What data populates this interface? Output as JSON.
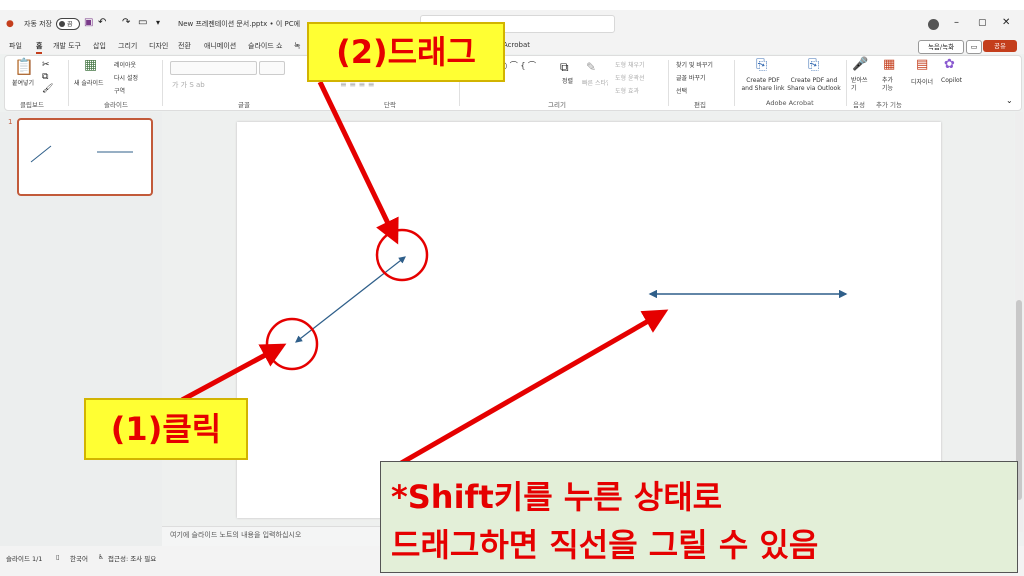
{
  "titlebar": {
    "autosave_label": "자동 저장",
    "autosave_state": "끔",
    "filename": "New 프레젠테이션 문서.pptx • 이 PC에 저장됨"
  },
  "menu": {
    "tabs": [
      "파일",
      "홈",
      "개발 도구",
      "삽입",
      "그리기",
      "디자인",
      "전환",
      "애니메이션",
      "슬라이드 쇼",
      "녹"
    ],
    "acrobat": "Acrobat",
    "active_tab": "홈"
  },
  "header_buttons": {
    "record": "녹음/녹화",
    "share": "공유"
  },
  "ribbon": {
    "clipboard": {
      "paste": "붙여넣기",
      "group": "클립보드"
    },
    "slides": {
      "new_slide": "새 슬라이드",
      "layout": "레이아웃",
      "reset": "다시 설정",
      "section": "구역",
      "group": "슬라이드"
    },
    "font": {
      "group": "글꼴"
    },
    "paragraph": {
      "group": "단락"
    },
    "drawing": {
      "arrange": "정렬",
      "quick_styles": "빠른 스타일",
      "fill": "도형 채우기",
      "outline": "도형 윤곽선",
      "effects": "도형 효과",
      "group": "그리기"
    },
    "editing": {
      "find": "찾기 및 바꾸기",
      "replace": "글꼴 바꾸기",
      "select": "선택",
      "group": "편집"
    },
    "acrobat": {
      "create_share_link": "Create PDF and Share link",
      "create_share_outlook": "Create PDF and Share via Outlook",
      "group": "Adobe Acrobat"
    },
    "voice": {
      "dictate": "받아쓰기",
      "group": "음성"
    },
    "addins": {
      "addins": "추가 기능",
      "group": "추가 기능"
    },
    "designer": "디자이너",
    "copilot": "Copilot"
  },
  "thumbnails": {
    "slide_number": "1"
  },
  "notes": {
    "placeholder": "여기에 슬라이드 노트의 내용을 입력하십시오"
  },
  "status": {
    "slide_count": "슬라이드 1/1",
    "language": "한국어",
    "accessibility": "접근성: 조사 필요"
  },
  "annotations": {
    "step2": "(2)드래그",
    "step1": "(1)클릭",
    "tip_line1": "*Shift키를 누른 상태로",
    "tip_line2": "드래그하면 직선을 그릴 수 있음"
  },
  "colors": {
    "accent": "#c43e1c",
    "annotation_red": "#e50000",
    "label_yellow": "#ffff33",
    "tip_bg": "#e3efd8",
    "line_blue": "#2f5f8a"
  }
}
